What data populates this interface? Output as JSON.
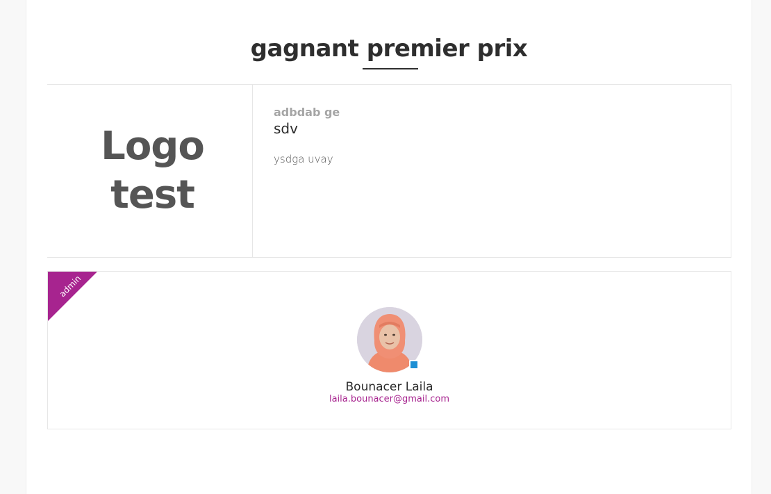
{
  "page": {
    "title": "gagnant premier prix"
  },
  "prize_card": {
    "logo_line1": "Logo",
    "logo_line2": "test",
    "label": "adbdab ge",
    "name": "sdv",
    "description": "ysdga uvay"
  },
  "member_card": {
    "role_badge": "admin",
    "name": "Bounacer Laila",
    "email": "laila.bounacer@gmail.com",
    "avatar_icon": "user-avatar-photo",
    "accent_color": "#a7248f",
    "status_color": "#1d8fd4"
  }
}
